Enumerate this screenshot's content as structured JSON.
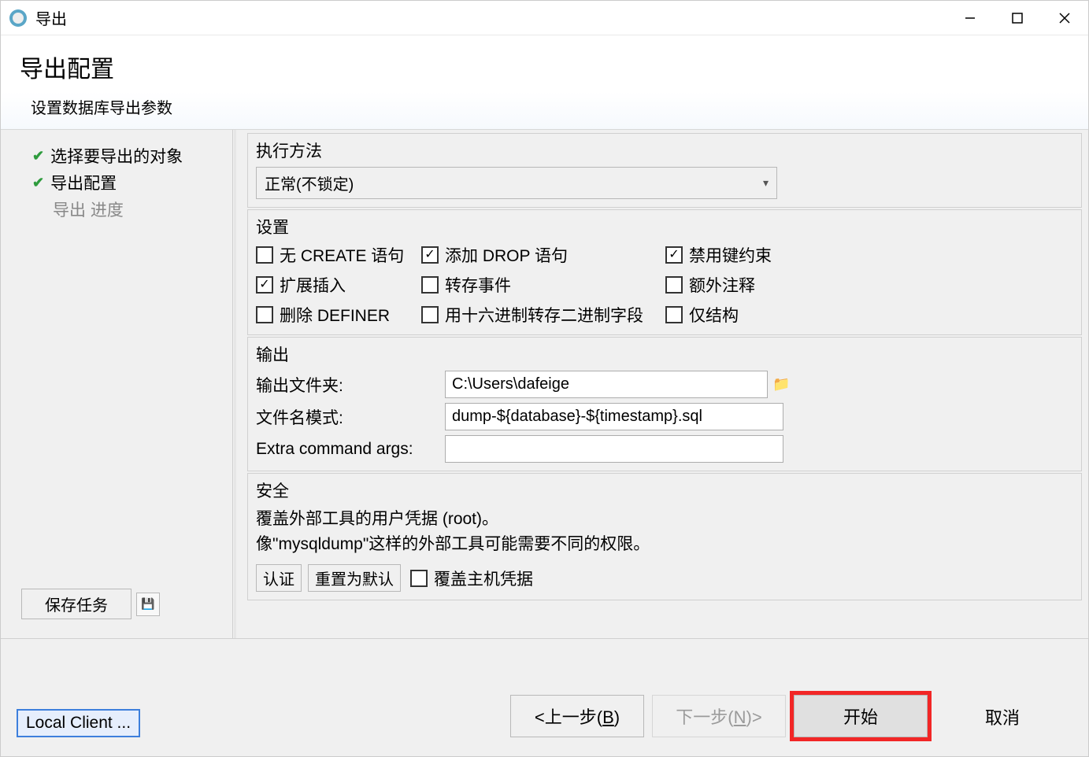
{
  "window": {
    "title": "导出"
  },
  "header": {
    "title": "导出配置",
    "subtitle": "设置数据库导出参数"
  },
  "sidebar": {
    "items": [
      {
        "label": "选择要导出的对象",
        "done": true
      },
      {
        "label": "导出配置",
        "done": true
      },
      {
        "label": "导出 进度",
        "done": false
      }
    ],
    "save_btn": "保存任务"
  },
  "exec": {
    "title": "执行方法",
    "method": "正常(不锁定)"
  },
  "settings": {
    "title": "设置",
    "no_create": "无 CREATE 语句",
    "add_drop": "添加 DROP 语句",
    "disable_keys": "禁用键约束",
    "extended_insert": "扩展插入",
    "dump_events": "转存事件",
    "extra_comments": "额外注释",
    "remove_definer": "删除 DEFINER",
    "hex_binary": "用十六进制转存二进制字段",
    "structure_only": "仅结构",
    "checked": {
      "no_create": false,
      "add_drop": true,
      "disable_keys": true,
      "extended_insert": true,
      "dump_events": false,
      "extra_comments": false,
      "remove_definer": false,
      "hex_binary": false,
      "structure_only": false
    }
  },
  "output": {
    "title": "输出",
    "folder_label": "输出文件夹:",
    "folder_value": "C:\\Users\\dafeige",
    "pattern_label": "文件名模式:",
    "pattern_value": "dump-${database}-${timestamp}.sql",
    "extra_label": "Extra command args:",
    "extra_value": ""
  },
  "security": {
    "title": "安全",
    "line1": "覆盖外部工具的用户凭据 (root)。",
    "line2": "像\"mysqldump\"这样的外部工具可能需要不同的权限。",
    "auth_btn": "认证",
    "reset_btn": "重置为默认",
    "override_host": "覆盖主机凭据"
  },
  "footer": {
    "local_client": "Local Client ...",
    "back_prefix": "<上一步(",
    "back_letter": "B",
    "back_suffix": ")",
    "next_prefix": "下一步(",
    "next_letter": "N",
    "next_suffix": ")>",
    "start": "开始",
    "cancel": "取消"
  }
}
